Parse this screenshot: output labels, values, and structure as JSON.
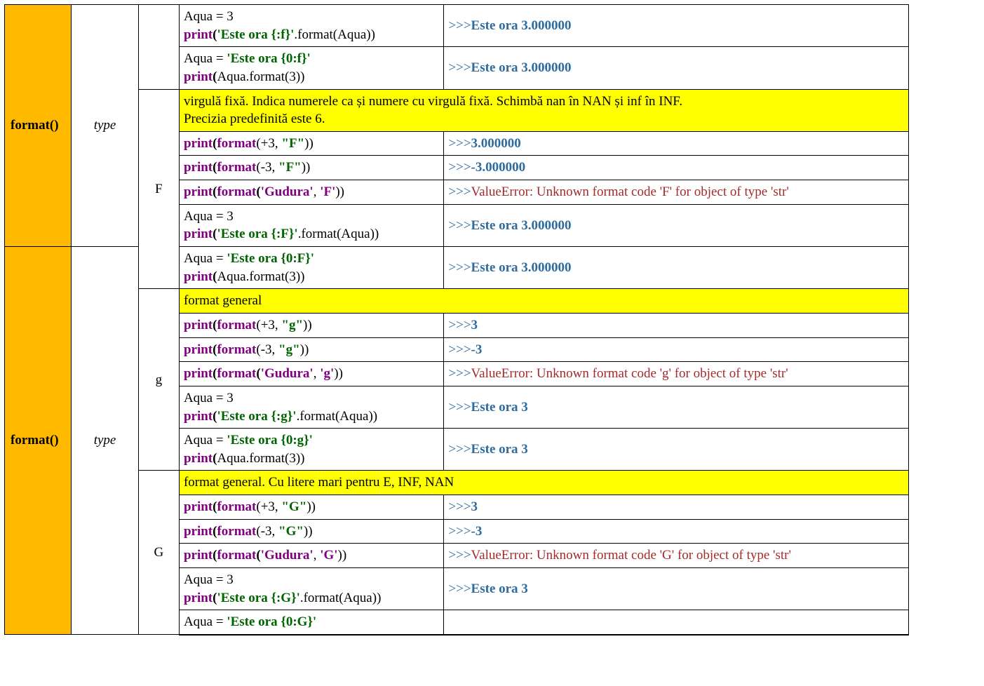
{
  "func1": "format()",
  "func2": "format()",
  "param1": "type",
  "param2": "type",
  "types": {
    "F": "F",
    "g": "g",
    "G": "G"
  },
  "desc": {
    "F": "virgulă fixă. Indica numerele ca și numere cu virgulă fixă. Schimbă nan în NAN și inf în INF.\nPrecizia predefinită este 6.",
    "g": "format general",
    "G": "format general. Cu litere mari pentru E, INF, NAN"
  },
  "code": {
    "f_ex4_l1": "Aqua = 3",
    "f_ex4_p": "print",
    "f_ex4_po": "(",
    "f_ex4_s": "'Este ora {:f}'",
    "f_ex4_d": ".format(Aqua))",
    "f_ex5_l1a": "Aqua = ",
    "f_ex5_l1b": "'Este ora {0:f}'",
    "f_ex5_p": "print",
    "f_ex5_po": "(",
    "f_ex5_rest": "Aqua.format(3))",
    "F_ex1_p": "print",
    "F_ex1_po": "(",
    "F_ex1_fn": "format",
    "F_ex1_a": "(+3, ",
    "F_ex1_s": "\"F\"",
    "F_ex1_c": "))",
    "F_ex2_p": "print",
    "F_ex2_po": "(",
    "F_ex2_fn": "format",
    "F_ex2_a": "(-3, ",
    "F_ex2_s": "\"F\"",
    "F_ex2_c": "))",
    "F_ex3_p": "print",
    "F_ex3_po": "(",
    "F_ex3_fn": "format",
    "F_ex3_a": "(",
    "F_ex3_s1": "'Gudura'",
    "F_ex3_m": ", ",
    "F_ex3_s2": "'F'",
    "F_ex3_c": "))",
    "F_ex4_l1": "Aqua = 3",
    "F_ex4_p": "print",
    "F_ex4_po": "(",
    "F_ex4_s": "'Este ora {:F}'",
    "F_ex4_d": ".format(Aqua))",
    "F_ex5_l1a": "Aqua = ",
    "F_ex5_l1b": "'Este ora {0:F}'",
    "F_ex5_p": "print",
    "F_ex5_po": "(",
    "F_ex5_rest": "Aqua.format(3))",
    "g_ex1_p": "print",
    "g_ex1_po": "(",
    "g_ex1_fn": "format",
    "g_ex1_a": "(+3, ",
    "g_ex1_s": "\"g\"",
    "g_ex1_c": "))",
    "g_ex2_p": "print",
    "g_ex2_po": "(",
    "g_ex2_fn": "format",
    "g_ex2_a": "(-3, ",
    "g_ex2_s": "\"g\"",
    "g_ex2_c": "))",
    "g_ex3_p": "print",
    "g_ex3_po": "(",
    "g_ex3_fn": "format",
    "g_ex3_a": "(",
    "g_ex3_s1": "'Gudura'",
    "g_ex3_m": ", ",
    "g_ex3_s2": "'g'",
    "g_ex3_c": "))",
    "g_ex4_l1": "Aqua = 3",
    "g_ex4_p": "print",
    "g_ex4_po": "(",
    "g_ex4_s": "'Este ora {:g}'",
    "g_ex4_d": ".format(Aqua))",
    "g_ex5_l1a": "Aqua = ",
    "g_ex5_l1b": "'Este ora {0:g}'",
    "g_ex5_p": "print",
    "g_ex5_po": "(",
    "g_ex5_rest": "Aqua.format(3))",
    "G_ex1_p": "print",
    "G_ex1_po": "(",
    "G_ex1_fn": "format",
    "G_ex1_a": "(+3, ",
    "G_ex1_s": "\"G\"",
    "G_ex1_c": "))",
    "G_ex2_p": "print",
    "G_ex2_po": "(",
    "G_ex2_fn": "format",
    "G_ex2_a": "(-3, ",
    "G_ex2_s": "\"G\"",
    "G_ex2_c": "))",
    "G_ex3_p": "print",
    "G_ex3_po": "(",
    "G_ex3_fn": "format",
    "G_ex3_a": "(",
    "G_ex3_s1": "'Gudura'",
    "G_ex3_m": ", ",
    "G_ex3_s2": "'G'",
    "G_ex3_c": "))",
    "G_ex4_l1": "Aqua = 3",
    "G_ex4_p": "print",
    "G_ex4_po": "(",
    "G_ex4_s": "'Este ora {:G}'",
    "G_ex4_d": ".format(Aqua))",
    "G_ex5_l1a": "Aqua = ",
    "G_ex5_l1b": "'Este ora {0:G}'"
  },
  "out": {
    "prompt": ">>>",
    "f_ex4": "Este ora 3.000000",
    "f_ex5": "Este ora 3.000000",
    "F_ex1": "3.000000",
    "F_ex2": "-3.000000",
    "F_ex3": "ValueError: Unknown format code 'F' for object of type 'str'",
    "F_ex4": "Este ora 3.000000",
    "F_ex5": "Este ora 3.000000",
    "g_ex1": "3",
    "g_ex2": "-3",
    "g_ex3": "ValueError: Unknown format code 'g' for object of type 'str'",
    "g_ex4": "Este ora 3",
    "g_ex5": "Este ora 3",
    "G_ex1": "3",
    "G_ex2": "-3",
    "G_ex3": "ValueError: Unknown format code 'G' for object of type 'str'",
    "G_ex4": "Este ora 3"
  }
}
